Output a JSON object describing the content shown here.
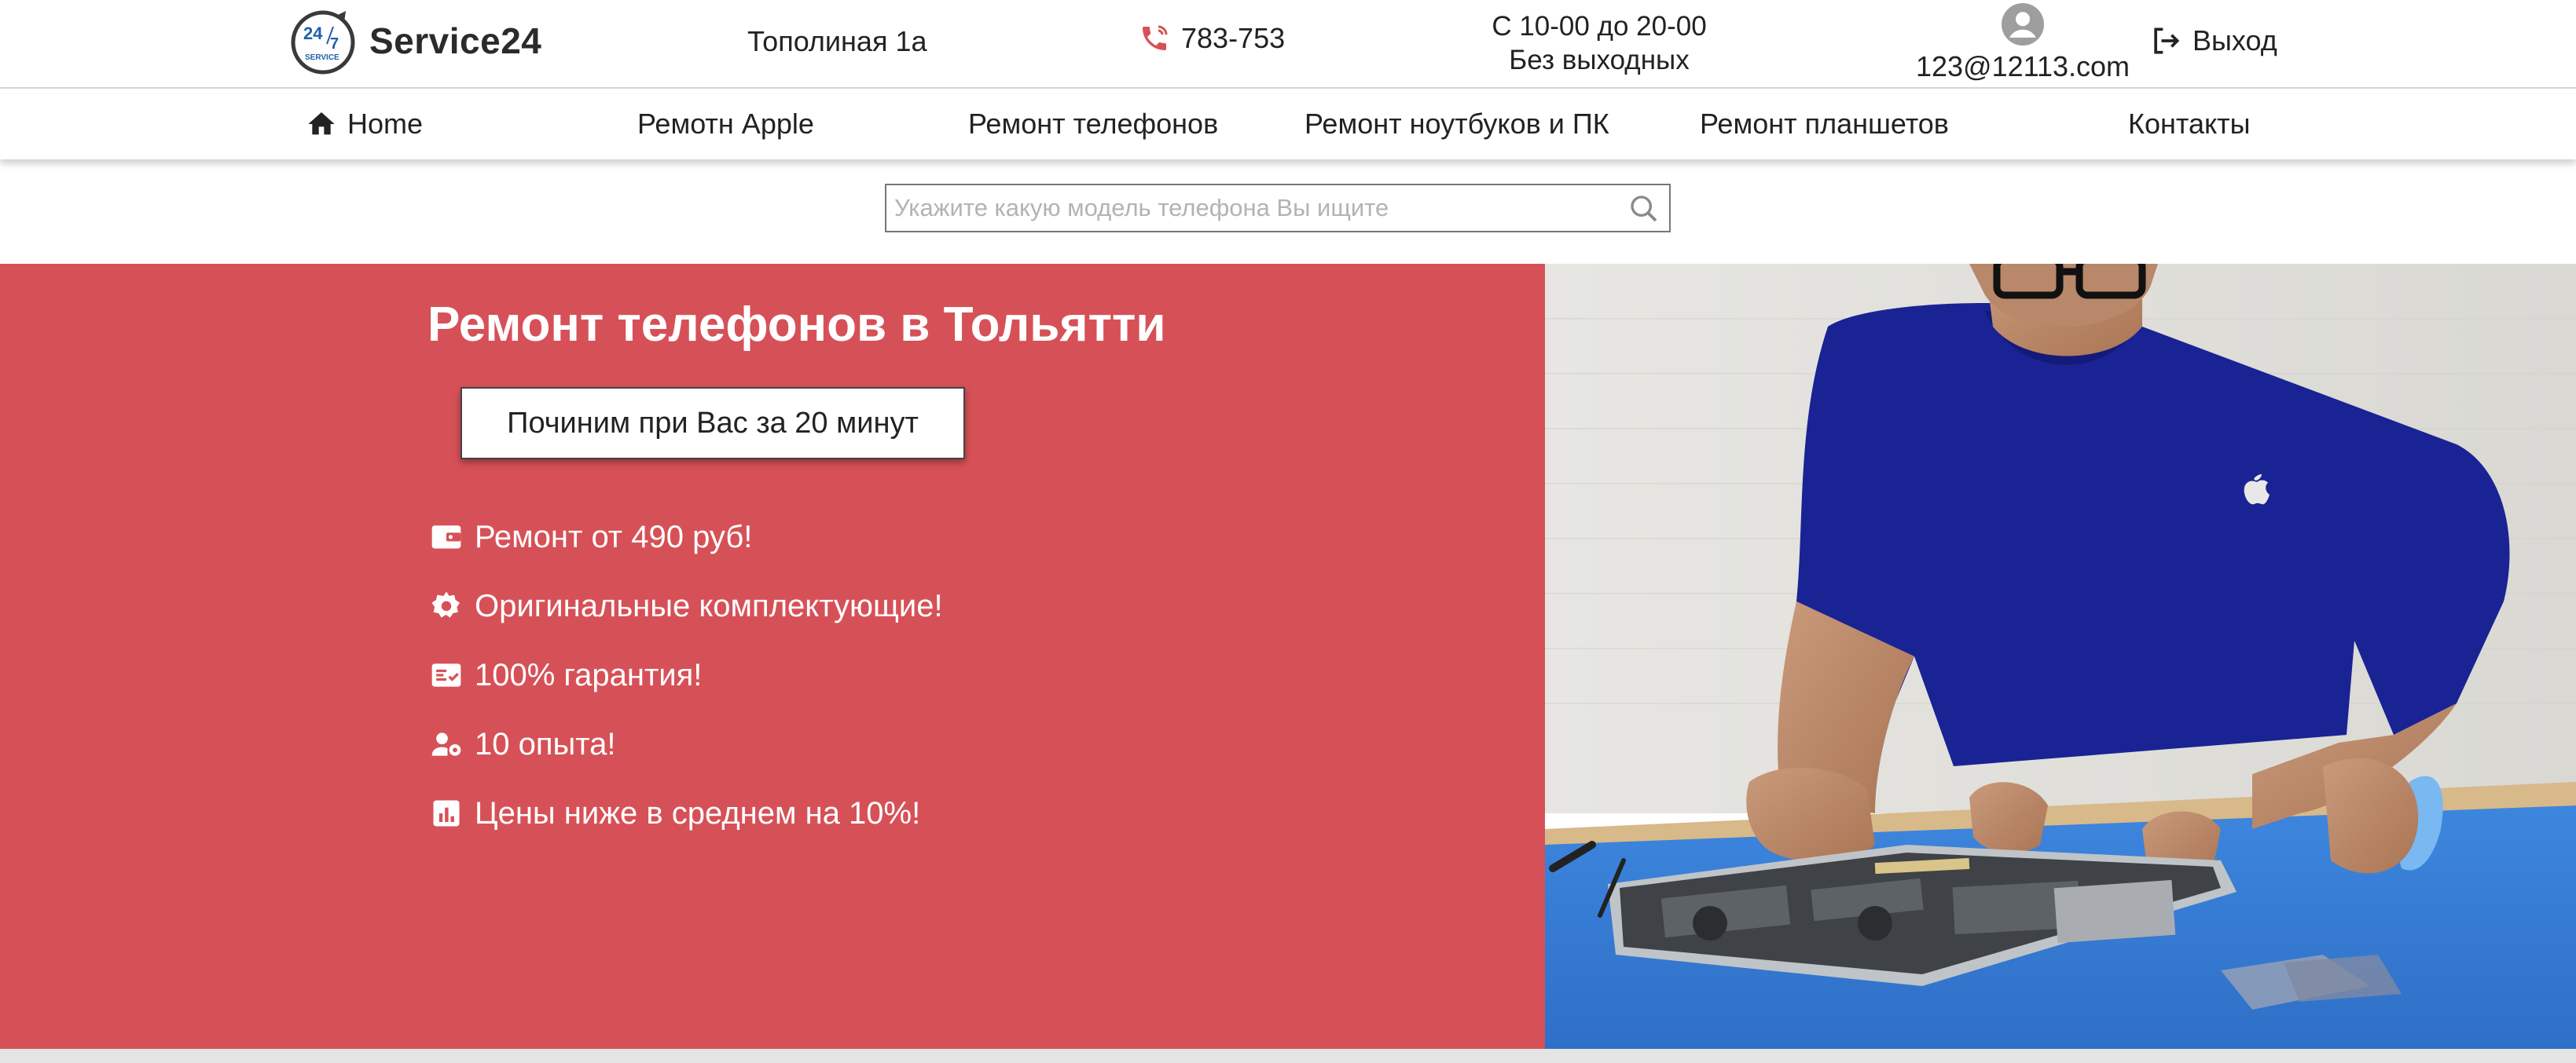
{
  "header": {
    "logo_text": "Service24",
    "logo_badge_top": "24",
    "logo_badge_num": "7",
    "logo_badge_bottom": "SERVICE",
    "address": "Тополиная 1а",
    "phone": "783-753",
    "hours_line1": "С 10-00 до 20-00",
    "hours_line2": "Без выходных",
    "email": "123@12113.com",
    "logout_label": "Выход",
    "accent_color": "#d65157"
  },
  "nav": {
    "items": [
      {
        "label": "Home",
        "icon": "home-icon"
      },
      {
        "label": "Ремотн Apple"
      },
      {
        "label": "Ремонт телефонов"
      },
      {
        "label": "Ремонт ноутбуков и ПК"
      },
      {
        "label": "Ремонт планшетов"
      },
      {
        "label": "Контакты"
      }
    ]
  },
  "search": {
    "placeholder": "Укажите какую модель телефона Вы ищите",
    "value": ""
  },
  "hero": {
    "title": "Ремонт телефонов в Тольятти",
    "cta_label": "Починим при Вас за 20 минут",
    "features": [
      {
        "text": "Ремонт от 490 руб!",
        "icon": "wallet-icon"
      },
      {
        "text": "Оригинальные комплектующие!",
        "icon": "gear-icon"
      },
      {
        "text": "100% гарантия!",
        "icon": "checklist-icon"
      },
      {
        "text": "10 опыта!",
        "icon": "user-gear-icon"
      },
      {
        "text": "Цены ниже в среднем на 10%!",
        "icon": "chart-icon"
      }
    ],
    "background_color": "#d65157",
    "photo_logo_icon": "apple-logo-icon"
  }
}
